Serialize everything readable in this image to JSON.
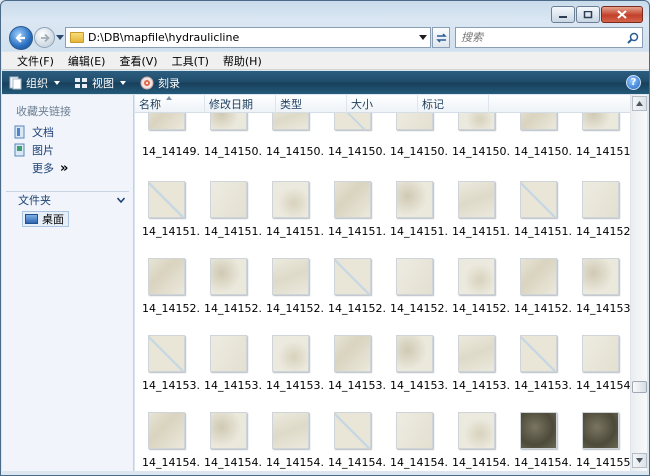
{
  "window": {
    "caption_buttons": [
      "minimize-icon",
      "maximize-icon",
      "close-icon"
    ]
  },
  "nav": {
    "address_path": "D:\\DB\\mapfile\\hydraulicline",
    "search_placeholder": "搜索"
  },
  "menu": [
    "文件(F)",
    "编辑(E)",
    "查看(V)",
    "工具(T)",
    "帮助(H)"
  ],
  "commands": {
    "organize": "组织",
    "views": "视图",
    "burn": "刻录"
  },
  "sidebar": {
    "favorites_heading": "收藏夹链接",
    "links": [
      "文档",
      "图片"
    ],
    "more": "更多",
    "more_glyph": "»",
    "folders_heading": "文件夹",
    "desktop": "桌面"
  },
  "columns": [
    "名称",
    "修改日期",
    "类型",
    "大小",
    "标记"
  ],
  "files": {
    "rows": [
      [
        "14_14149...",
        "14_14150...",
        "14_14150...",
        "14_14150...",
        "14_14150...",
        "14_14150...",
        "14_14150...",
        "14_14151..."
      ],
      [
        "14_14151...",
        "14_14151...",
        "14_14151...",
        "14_14151...",
        "14_14151...",
        "14_14151...",
        "14_14151...",
        "14_14152..."
      ],
      [
        "14_14152...",
        "14_14152...",
        "14_14152...",
        "14_14152...",
        "14_14152...",
        "14_14152...",
        "14_14152...",
        "14_14153..."
      ],
      [
        "14_14153...",
        "14_14153...",
        "14_14153...",
        "14_14153...",
        "14_14153...",
        "14_14153...",
        "14_14153...",
        "14_14154..."
      ],
      [
        "14_14154...",
        "14_14154...",
        "14_14154...",
        "14_14154...",
        "14_14154...",
        "14_14154...",
        "14_14154...",
        "14_14155..."
      ]
    ]
  },
  "colors": {
    "cmdbar": "#1f4b69",
    "link": "#1b3f73",
    "map_beige": "#ebe9dd",
    "map_water": "#a9c8e2",
    "satellite": "#5d5a47"
  }
}
